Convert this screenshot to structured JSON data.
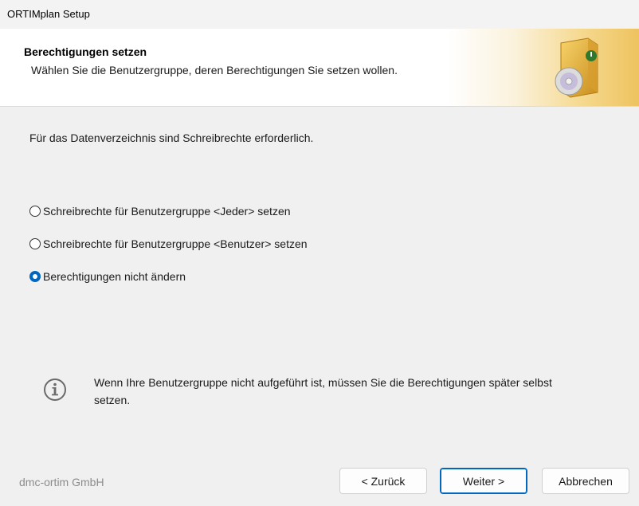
{
  "window": {
    "title": "ORTIMplan Setup"
  },
  "header": {
    "heading": "Berechtigungen setzen",
    "subtitle": "Wählen Sie die Benutzergruppe, deren Berechtigungen Sie setzen wollen.",
    "icon": "setup-box-icon"
  },
  "body": {
    "info": "Für das Datenverzeichnis sind Schreibrechte erforderlich.",
    "options": [
      {
        "label": "Schreibrechte für Benutzergruppe <Jeder> setzen",
        "checked": false
      },
      {
        "label": "Schreibrechte für Benutzergruppe <Benutzer> setzen",
        "checked": false
      },
      {
        "label": "Berechtigungen nicht ändern",
        "checked": true
      }
    ],
    "hint": {
      "icon": "info-icon",
      "text": "Wenn Ihre Benutzergruppe nicht aufgeführt ist, müssen Sie die Berechtigungen später selbst setzen."
    }
  },
  "footer": {
    "brand": "dmc-ortim GmbH",
    "back_label": "< Zurück",
    "next_label": "Weiter >",
    "cancel_label": "Abbrechen"
  },
  "colors": {
    "accent": "#0067c0",
    "banner": "#eec35f"
  }
}
